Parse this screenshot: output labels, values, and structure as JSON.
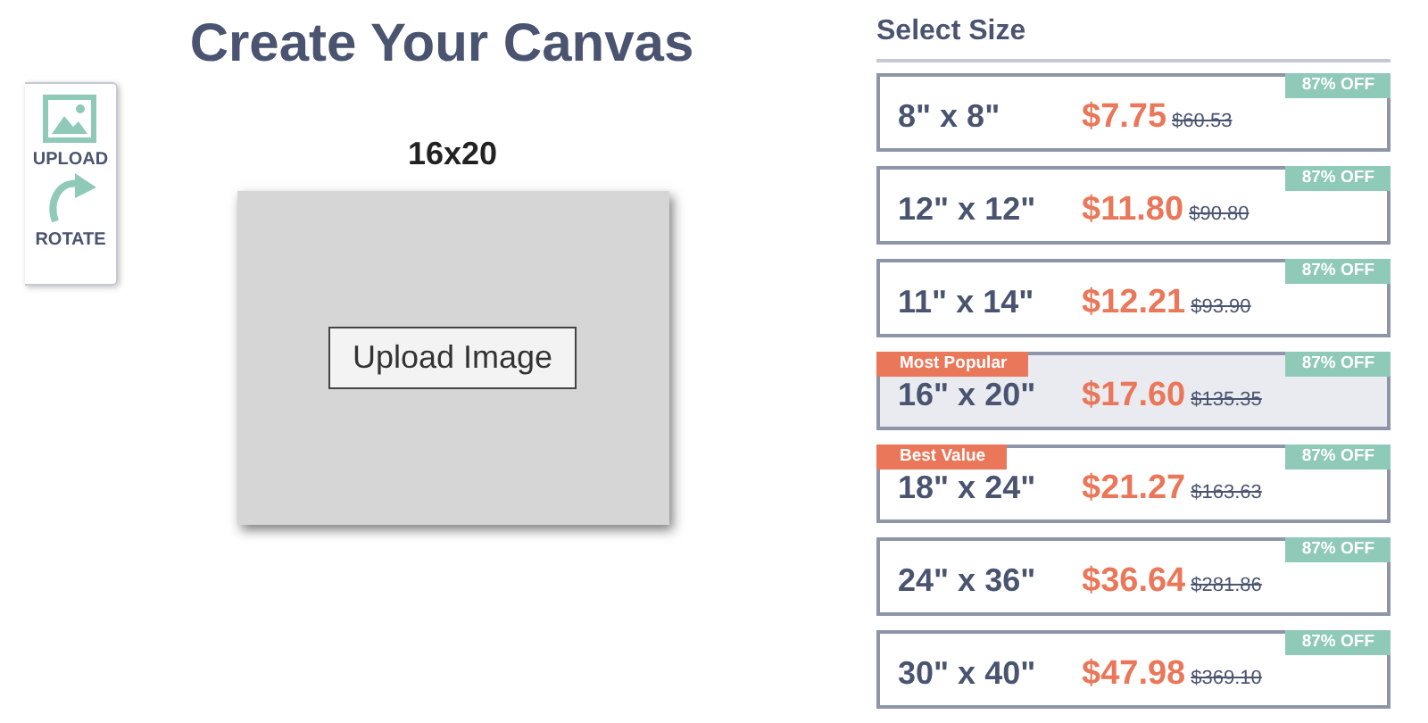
{
  "editor": {
    "title": "Create Your Canvas",
    "tools": [
      {
        "kind": "upload",
        "label": "UPLOAD"
      },
      {
        "kind": "rotate",
        "label": "ROTATE"
      }
    ],
    "canvas_size": "16x20",
    "upload_button": "Upload Image"
  },
  "size_panel": {
    "title": "Select Size",
    "options": [
      {
        "size": "8\" x 8\"",
        "price": "$7.75",
        "old_price": "$60.53",
        "discount": "87% OFF",
        "selected": false
      },
      {
        "size": "12\" x 12\"",
        "price": "$11.80",
        "old_price": "$90.80",
        "discount": "87% OFF",
        "selected": false
      },
      {
        "size": "11\" x 14\"",
        "price": "$12.21",
        "old_price": "$93.90",
        "discount": "87% OFF",
        "selected": false
      },
      {
        "size": "16\" x 20\"",
        "price": "$17.60",
        "old_price": "$135.35",
        "discount": "87% OFF",
        "selected": true,
        "badge": "Most Popular"
      },
      {
        "size": "18\" x 24\"",
        "price": "$21.27",
        "old_price": "$163.63",
        "discount": "87% OFF",
        "selected": false,
        "badge": "Best Value"
      },
      {
        "size": "24\" x 36\"",
        "price": "$36.64",
        "old_price": "$281.86",
        "discount": "87% OFF",
        "selected": false
      },
      {
        "size": "30\" x 40\"",
        "price": "$47.98",
        "old_price": "$369.10",
        "discount": "87% OFF",
        "selected": false
      }
    ]
  }
}
